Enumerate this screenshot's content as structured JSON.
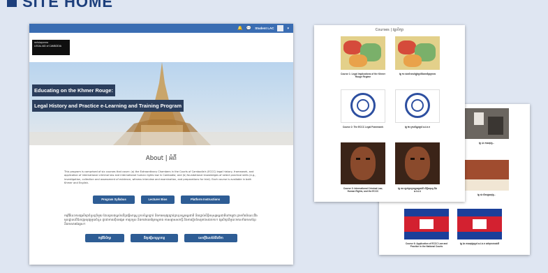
{
  "slide": {
    "title": "SITE HOME"
  },
  "topbar": {
    "user": "Student LAC",
    "bell_icon": "bell-icon",
    "chat_icon": "chat-icon"
  },
  "logo": {
    "line1": "ទាក់ទងតុលាការ",
    "line2": "LEGAL AID of CAMBODIA"
  },
  "hero": {
    "title_line1": "Educating on the Khmer Rouge:",
    "title_line2": "Legal History and Practice e-Learning and Training Program"
  },
  "about": {
    "title": "About | អំពី",
    "body": "This program is comprised of six courses that cover: (a) the Extraordinary Chambers in the Courts of Cambodia's (ECCC) legal history, framework, and application of international criminal law and international human rights law in Cambodia; and (b) foundational knowledges of select practical skills (e.g., investigation, collection and assessment of evidence, witness interview and examination, and preparations for trial). Each course is available in both Khmer and English.",
    "buttons": [
      "Program Syllabus",
      "Lecturer Bios",
      "Platform Instructions"
    ],
    "khmer_body": "កម្មវិធីនេះមានវគ្គសិក្សាចំនួនប្រាំមួយ ដែលគ្របដណ្តប់លើប្រវត្តិសាស្ត្រ ក្របខ័ណ្ឌច្បាប់ និងការអនុវត្តច្បាប់ព្រហ្មទណ្ឌអន្តរជាតិ និងច្បាប់សិទ្ធិមនុស្សអន្តរជាតិនៅកម្ពុជា ព្រមទាំងចំណេះដឹងមូលដ្ឋានលើជំនាញអនុវត្តមួយចំនួន ដូចជាការស៊ើបអង្កេត ការប្រមូល និងការវាយតម្លៃភស្តុតាង ការសម្ភាសសាក្សី និងការរៀបចំសម្រាប់សវនាការ។ វគ្គសិក្សានីមួយៗមានទាំងភាសាខ្មែរ និងភាសាអង់គ្លេស។",
    "khmer_buttons": [
      "កម្មវិធីសិក្សា",
      "ជីវប្រវត្តិសាស្ត្រាចារ្យ",
      "សេចក្តីណែនាំអំពីវេទិកា"
    ]
  },
  "courses": {
    "title": "Courses | វគ្គសិក្សា",
    "tiles": [
      {
        "caption": "Course 1: Legal Implications of the Khmer Rouge Regime"
      },
      {
        "caption": "វគ្គ ១៖ ផលប៉ះពាល់ផ្លូវច្បាប់នៃរបបខ្មែរក្រហម"
      },
      {
        "caption": "Course 2: The ECCC Legal Framework"
      },
      {
        "caption": "វគ្គ ២៖ ក្របខ័ណ្ឌច្បាប់ អ.វ.ត.ក"
      },
      {
        "caption": "Course 3: International Criminal Law, Human Rights, and the ECCC"
      },
      {
        "caption": "វគ្គ ៣៖ ច្បាប់ព្រហ្មទណ្ឌអន្តរជាតិ សិទ្ធិមនុស្ស និង អ.វ.ត.ក"
      }
    ]
  },
  "courses2": {
    "tiles": [
      {
        "caption": "វគ្គ ៤៖ ការអនុវត្ត..."
      },
      {
        "caption": "វគ្គ ៥៖ ជំនាញអនុវត្ត..."
      },
      {
        "caption": "Course 6: Application of ECCC Law and Practice in the National Courts"
      },
      {
        "caption": "វគ្គ ៦៖ ការអនុវត្តច្បាប់ អ.វ.ត.ក នៅតុលាការជាតិ"
      }
    ]
  },
  "colors": {
    "topbar": "#3a6db3",
    "button": "#2e5d95",
    "hero_box": "#2b3e5c",
    "slide_title": "#1d3f7c"
  }
}
